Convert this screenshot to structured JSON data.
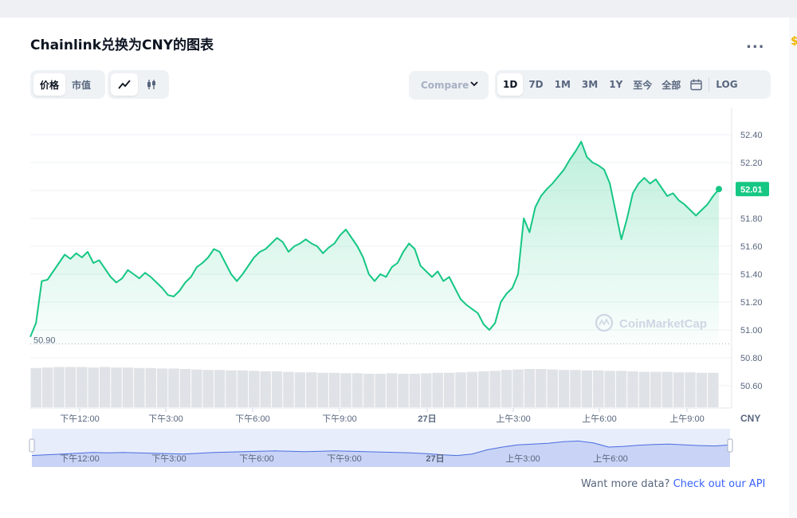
{
  "header": {
    "title": "Chainlink兑换为CNY的图表",
    "more": "..."
  },
  "toolbar": {
    "view_tabs": [
      "价格",
      "市值"
    ],
    "compare": "Compare",
    "ranges": [
      "1D",
      "7D",
      "1M",
      "3M",
      "1Y",
      "至今",
      "全部"
    ],
    "log": "LOG",
    "active_range": "1D"
  },
  "chart_data": {
    "type": "area",
    "currency_label": "CNY",
    "x_ticks": [
      "下午12:00",
      "下午3:00",
      "下午6:00",
      "下午9:00",
      "27日",
      "上午3:00",
      "上午6:00",
      "上午9:00"
    ],
    "navigator_ticks": [
      "下午12:00",
      "下午3:00",
      "下午6:00",
      "下午9:00",
      "27日",
      "上午3:00",
      "上午6:00"
    ],
    "y_ticks": [
      "52.40",
      "52.20",
      "52.00",
      "51.80",
      "51.60",
      "51.40",
      "51.20",
      "51.00",
      "50.80",
      "50.60"
    ],
    "ylim": [
      50.6,
      52.4
    ],
    "baseline_label": "50.90",
    "last_price_label": "52.01",
    "watermark": "CoinMarketCap",
    "line_color": "#16c784",
    "price": [
      50.95,
      51.05,
      51.35,
      51.36,
      51.42,
      51.48,
      51.54,
      51.51,
      51.55,
      51.52,
      51.56,
      51.48,
      51.5,
      51.44,
      51.38,
      51.34,
      51.37,
      51.43,
      51.4,
      51.37,
      51.41,
      51.38,
      51.34,
      51.3,
      51.25,
      51.24,
      51.28,
      51.34,
      51.38,
      51.45,
      51.48,
      51.52,
      51.58,
      51.56,
      51.48,
      51.4,
      51.35,
      51.4,
      51.46,
      51.52,
      51.56,
      51.58,
      51.62,
      51.66,
      51.63,
      51.56,
      51.6,
      51.62,
      51.65,
      51.62,
      51.6,
      51.55,
      51.59,
      51.62,
      51.68,
      51.72,
      51.66,
      51.6,
      51.52,
      51.4,
      51.35,
      51.4,
      51.38,
      51.45,
      51.48,
      51.56,
      51.62,
      51.58,
      51.46,
      51.42,
      51.38,
      51.42,
      51.35,
      51.38,
      51.3,
      51.22,
      51.18,
      51.15,
      51.12,
      51.04,
      51.0,
      51.05,
      51.2,
      51.26,
      51.3,
      51.4,
      51.8,
      51.7,
      51.88,
      51.96,
      52.01,
      52.05,
      52.1,
      52.15,
      52.22,
      52.28,
      52.35,
      52.24,
      52.2,
      52.18,
      52.15,
      52.05,
      51.85,
      51.65,
      51.8,
      51.98,
      52.05,
      52.09,
      52.05,
      52.08,
      52.02,
      51.96,
      51.98,
      51.93,
      51.9,
      51.86,
      51.82,
      51.86,
      51.9,
      51.96,
      52.01
    ],
    "volume": [
      0.82,
      0.83,
      0.84,
      0.84,
      0.84,
      0.83,
      0.84,
      0.83,
      0.83,
      0.82,
      0.82,
      0.81,
      0.81,
      0.8,
      0.79,
      0.78,
      0.78,
      0.77,
      0.77,
      0.76,
      0.75,
      0.75,
      0.74,
      0.73,
      0.73,
      0.72,
      0.72,
      0.71,
      0.71,
      0.7,
      0.7,
      0.71,
      0.7,
      0.7,
      0.71,
      0.72,
      0.72,
      0.73,
      0.74,
      0.75,
      0.76,
      0.78,
      0.79,
      0.8,
      0.8,
      0.79,
      0.78,
      0.78,
      0.77,
      0.77,
      0.76,
      0.76,
      0.75,
      0.74,
      0.74,
      0.74,
      0.73,
      0.73,
      0.72,
      0.72
    ],
    "navigator": [
      0.3,
      0.32,
      0.34,
      0.36,
      0.38,
      0.37,
      0.38,
      0.37,
      0.36,
      0.35,
      0.34,
      0.36,
      0.38,
      0.39,
      0.4,
      0.41,
      0.42,
      0.41,
      0.4,
      0.41,
      0.42,
      0.41,
      0.4,
      0.39,
      0.38,
      0.37,
      0.35,
      0.32,
      0.3,
      0.34,
      0.45,
      0.52,
      0.58,
      0.6,
      0.62,
      0.66,
      0.68,
      0.63,
      0.52,
      0.54,
      0.57,
      0.59,
      0.6,
      0.58,
      0.56,
      0.55,
      0.58
    ]
  },
  "footer": {
    "text": "Want more data?",
    "link": "Check out our API"
  }
}
